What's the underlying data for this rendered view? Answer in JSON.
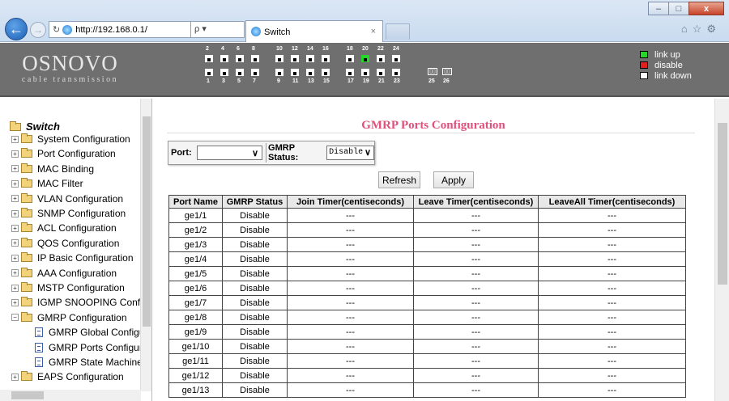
{
  "browser": {
    "address": "http://192.168.0.1/",
    "search_hint": "ρ ▾",
    "tab_title": "Switch",
    "tab_close": "×",
    "window_buttons": [
      "–",
      "□",
      "x"
    ],
    "toolbar_icons": "⌂☆⚙"
  },
  "header": {
    "logo_main": "OSNOVO",
    "logo_sub": "cable transmission",
    "ports_top": [
      "2",
      "4",
      "6",
      "8",
      "10",
      "12",
      "14",
      "16",
      "18",
      "20",
      "22",
      "24"
    ],
    "ports_bottom": [
      "1",
      "3",
      "5",
      "7",
      "9",
      "11",
      "13",
      "15",
      "17",
      "19",
      "21",
      "23"
    ],
    "ports_up": [
      "20"
    ],
    "sfp_ports": [
      "25",
      "26"
    ],
    "legend": [
      {
        "label": "link up",
        "color": "#27d62b"
      },
      {
        "label": "disable",
        "color": "#e02020"
      },
      {
        "label": "link down",
        "color": "#ffffff"
      }
    ]
  },
  "sidebar": {
    "root": "Switch",
    "items": [
      "System Configuration",
      "Port Configuration",
      "MAC Binding",
      "MAC Filter",
      "VLAN Configuration",
      "SNMP Configuration",
      "ACL Configuration",
      "QOS Configuration",
      "IP Basic Configuration",
      "AAA Configuration",
      "MSTP Configuration",
      "IGMP SNOOPING Confi",
      "GMRP Configuration"
    ],
    "gmrp_children": [
      "GMRP Global Configu",
      "GMRP Ports Configur",
      "GMRP State Machine"
    ],
    "after": [
      "EAPS Configuration"
    ]
  },
  "main": {
    "title": "GMRP Ports Configuration",
    "port_label": "Port:",
    "port_value": "",
    "gmrp_status_label": "GMRP Status:",
    "gmrp_status_value": "Disable",
    "refresh_label": "Refresh",
    "apply_label": "Apply",
    "table": {
      "headers": [
        "Port Name",
        "GMRP Status",
        "Join Timer(centiseconds)",
        "Leave Timer(centiseconds)",
        "LeaveAll Timer(centiseconds)"
      ],
      "rows": [
        [
          "ge1/1",
          "Disable",
          "---",
          "---",
          "---"
        ],
        [
          "ge1/2",
          "Disable",
          "---",
          "---",
          "---"
        ],
        [
          "ge1/3",
          "Disable",
          "---",
          "---",
          "---"
        ],
        [
          "ge1/4",
          "Disable",
          "---",
          "---",
          "---"
        ],
        [
          "ge1/5",
          "Disable",
          "---",
          "---",
          "---"
        ],
        [
          "ge1/6",
          "Disable",
          "---",
          "---",
          "---"
        ],
        [
          "ge1/7",
          "Disable",
          "---",
          "---",
          "---"
        ],
        [
          "ge1/8",
          "Disable",
          "---",
          "---",
          "---"
        ],
        [
          "ge1/9",
          "Disable",
          "---",
          "---",
          "---"
        ],
        [
          "ge1/10",
          "Disable",
          "---",
          "---",
          "---"
        ],
        [
          "ge1/11",
          "Disable",
          "---",
          "---",
          "---"
        ],
        [
          "ge1/12",
          "Disable",
          "---",
          "---",
          "---"
        ],
        [
          "ge1/13",
          "Disable",
          "---",
          "---",
          "---"
        ]
      ]
    }
  }
}
